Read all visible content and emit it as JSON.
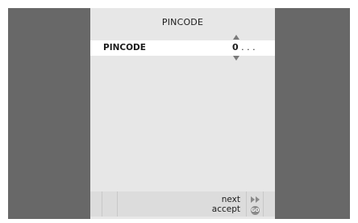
{
  "menu": {
    "title": "PINCODE",
    "field_label": "PINCODE",
    "field_digit": "0",
    "field_rest": " . . ."
  },
  "footer": {
    "next_label": "next",
    "accept_label": "accept",
    "go_icon_text": "GO"
  },
  "colors": {
    "side_bars": "#686868",
    "screen_bg": "#e7e7e7",
    "highlight_row": "#ffffff",
    "footer_bg": "#dcdcdc"
  },
  "icons": [
    "arrow-up-icon",
    "arrow-down-icon",
    "fast-forward-icon",
    "go-icon"
  ]
}
